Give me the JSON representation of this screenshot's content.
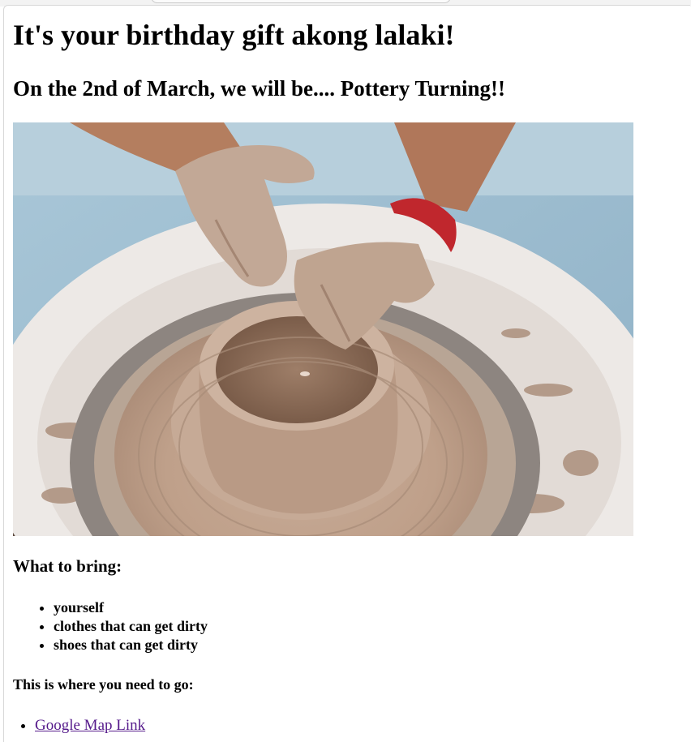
{
  "page": {
    "title": "It's your birthday gift akong lalaki!",
    "subtitle": "On the 2nd of March, we will be.... Pottery Turning!!"
  },
  "photo": {
    "alt": "Hands shaping clay on a pottery wheel"
  },
  "bring": {
    "heading": "What to bring:",
    "items": [
      "yourself",
      "clothes that can get dirty",
      "shoes that can get dirty"
    ]
  },
  "location": {
    "heading": "This is where you need to go:",
    "link_label": "Google Map Link"
  },
  "colors": {
    "link_visited": "#551a8b",
    "text": "#000000",
    "background": "#ffffff"
  }
}
